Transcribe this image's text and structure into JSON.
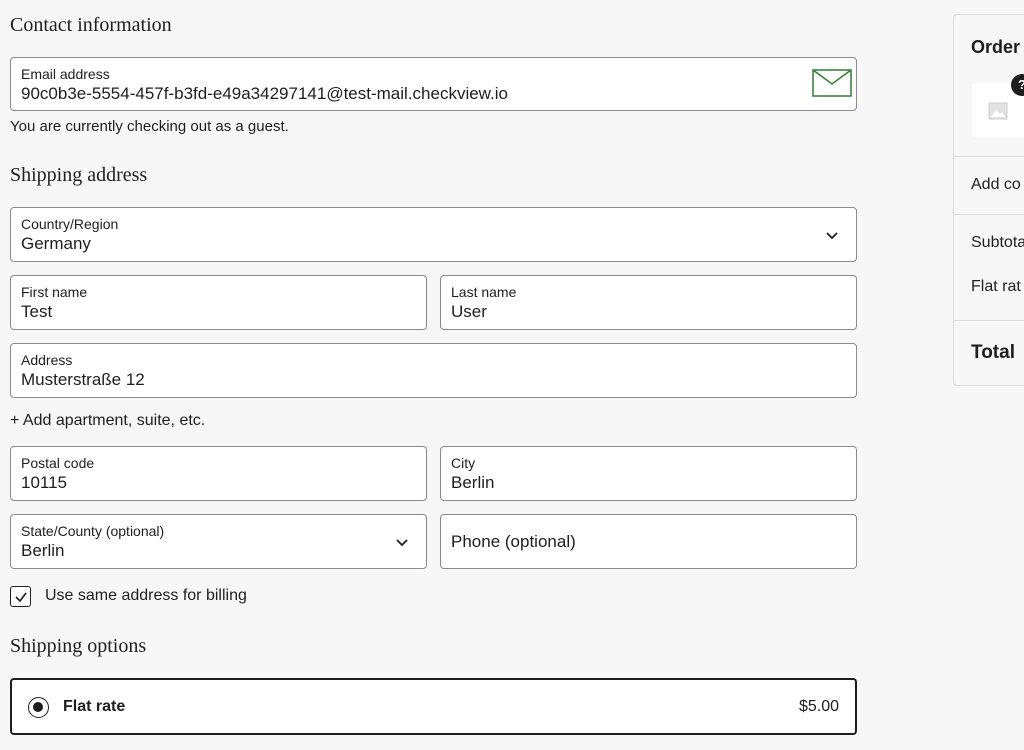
{
  "contact": {
    "title": "Contact information",
    "email_label": "Email address",
    "email_value": "90c0b3e-5554-457f-b3fd-e49a34297141@test-mail.checkview.io",
    "guest_note": "You are currently checking out as a guest."
  },
  "shipping": {
    "title": "Shipping address",
    "country_label": "Country/Region",
    "country_value": "Germany",
    "first_name_label": "First name",
    "first_name_value": "Test",
    "last_name_label": "Last name",
    "last_name_value": "User",
    "address_label": "Address",
    "address_value": "Musterstraße 12",
    "add_apartment": "+ Add apartment, suite, etc.",
    "postal_label": "Postal code",
    "postal_value": "10115",
    "city_label": "City",
    "city_value": "Berlin",
    "state_label": "State/County (optional)",
    "state_value": "Berlin",
    "phone_placeholder": "Phone (optional)",
    "billing_same_label": "Use same address for billing",
    "billing_same_checked": true
  },
  "shipping_options": {
    "title": "Shipping options",
    "selected_name": "Flat rate",
    "selected_price": "$5.00"
  },
  "summary": {
    "title": "Order",
    "badge": "?",
    "add_coupon": "Add co",
    "subtotal": "Subtota",
    "flat_rate": "Flat rat",
    "total": "Total"
  },
  "icons": {
    "email": "mail-icon",
    "dropdown": "chevron-down-icon",
    "checkbox": "checkmark-icon",
    "thumbnail": "image-placeholder-icon"
  },
  "colors": {
    "mail_icon": "#2e7d32",
    "text": "#1e1e1e",
    "background": "#f7f7f7"
  }
}
